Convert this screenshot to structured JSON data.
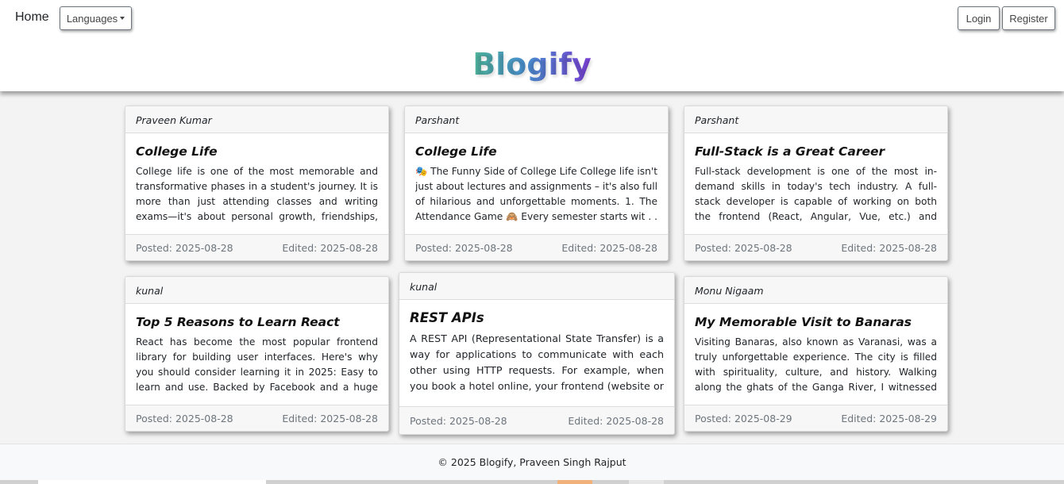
{
  "nav": {
    "home_label": "Home",
    "languages_label": "Languages",
    "login_label": "Login",
    "register_label": "Register"
  },
  "brand": {
    "title": "Blogify",
    "gradient_colors": [
      "#4fb69c",
      "#4a8fd1",
      "#7a3fd4"
    ]
  },
  "posts": [
    {
      "author": "Praveen Kumar",
      "title": "College Life",
      "excerpt": "College life is one of the most memorable and transformative phases in a student's journey. It is more than just attending classes and writing exams—it's about personal growth, friendships, freedom, a . . .",
      "posted": "Posted: 2025-08-28",
      "edited": "Edited: 2025-08-28"
    },
    {
      "author": "Parshant",
      "title": "College Life",
      "excerpt": "🎭 The Funny Side of College Life College life isn't just about lectures and assignments – it's also full of hilarious and unforgettable moments. 1. The Attendance Game 🙈 Every semester starts wit . . .",
      "posted": "Posted: 2025-08-28",
      "edited": "Edited: 2025-08-28"
    },
    {
      "author": "Parshant",
      "title": "Full-Stack is a Great Career",
      "excerpt": "Full-stack development is one of the most in-demand skills in today's tech industry. A full-stack developer is capable of working on both the frontend (React, Angular, Vue, etc.) and backend (Spring B . . .",
      "posted": "Posted: 2025-08-28",
      "edited": "Edited: 2025-08-28"
    },
    {
      "author": "kunal",
      "title": "Top 5 Reasons to Learn React",
      "excerpt": "React has become the most popular frontend library for building user interfaces. Here's why you should consider learning it in 2025: Easy to learn and use. Backed by Facebook and a huge community. . . .",
      "posted": "Posted: 2025-08-28",
      "edited": "Edited: 2025-08-28"
    },
    {
      "author": "kunal",
      "title": "REST APIs",
      "excerpt": "A REST API (Representational State Transfer) is a way for applications to communicate with each other using HTTP requests. For example, when you book a hotel online, your frontend (website or app) tal . . .",
      "posted": "Posted: 2025-08-28",
      "edited": "Edited: 2025-08-28"
    },
    {
      "author": "Monu Nigaam",
      "title": "My Memorable Visit to Banaras",
      "excerpt": "Visiting Banaras, also known as Varanasi, was a truly unforgettable experience. The city is filled with spirituality, culture, and history. Walking along the ghats of the Ganga River, I witnessed the . . .",
      "posted": "Posted: 2025-08-29",
      "edited": "Edited: 2025-08-29"
    }
  ],
  "footer": {
    "copyright": "© 2025 Blogify, Praveen Singh Rajput"
  }
}
